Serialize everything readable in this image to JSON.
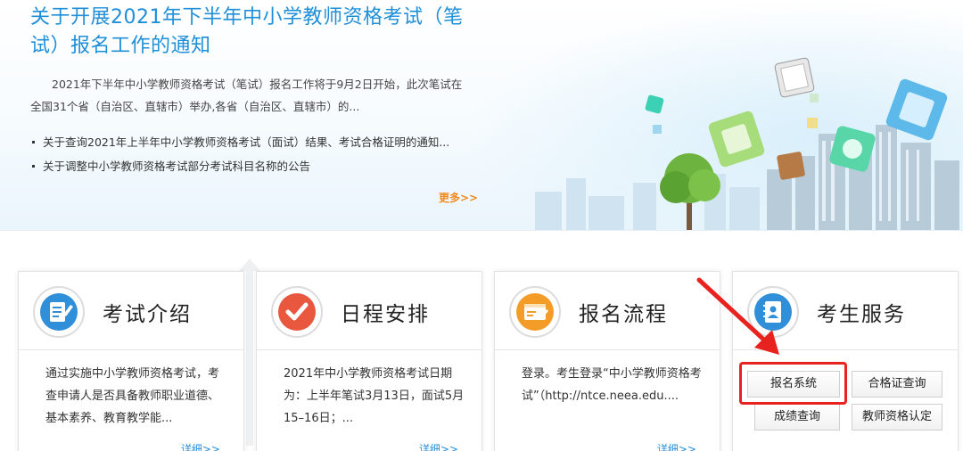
{
  "news": {
    "title": "关于开展2021年下半年中小学教师资格考试（笔试）报名工作的通知",
    "summary": "2021年下半年中小学教师资格考试（笔试）报名工作将于9月2日开始，此次笔试在全国31个省（自治区、直辖市）举办,各省（自治区、直辖市）的...",
    "items": [
      "关于查询2021年上半年中小学教师资格考试（面试）结果、考试合格证明的通知...",
      "关于调整中小学教师资格考试部分考试科目名称的公告"
    ],
    "more_label": "更多>>"
  },
  "cards": [
    {
      "title": "考试介绍",
      "desc": "通过实施中小学教师资格考试，考查申请人是否具备教师职业道德、基本素养、教育教学能...",
      "more": "详细>>",
      "icon": "document-edit-icon",
      "icon_color": "#2f8fd8"
    },
    {
      "title": "日程安排",
      "desc": "2021年中小学教师资格考试日期为：上半年笔试3月13日，面试5月15–16日；...",
      "more": "详细>>",
      "icon": "checkmark-icon",
      "icon_color": "#e9573f"
    },
    {
      "title": "报名流程",
      "desc": "登录。考生登录“中小学教师资格考试”（http://ntce.neea.edu....",
      "more": "详细>>",
      "icon": "registration-form-icon",
      "icon_color": "#f39c27"
    },
    {
      "title": "考生服务",
      "icon": "contact-book-icon",
      "icon_color": "#2f8fd8",
      "buttons": [
        "报名系统",
        "合格证查询",
        "成绩查询",
        "教师资格认定"
      ]
    }
  ],
  "colors": {
    "title_blue": "#1f8fd8",
    "more_orange": "#f08a1e",
    "highlight_red": "#e8231f"
  }
}
